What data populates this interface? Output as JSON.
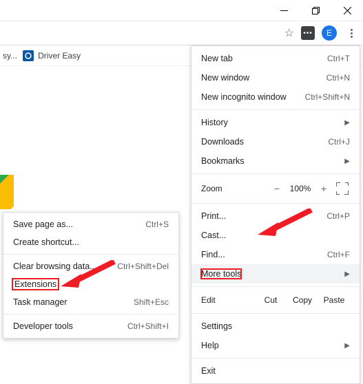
{
  "window": {
    "min": "—",
    "max": "❐",
    "close": "✕"
  },
  "toolbar": {
    "avatar_letter": "E",
    "ext_badge": "•••"
  },
  "bookmarks": {
    "truncated": "sy...",
    "driver_easy": "Driver Easy"
  },
  "menu": {
    "new_tab": "New tab",
    "new_tab_sc": "Ctrl+T",
    "new_window": "New window",
    "new_window_sc": "Ctrl+N",
    "incognito": "New incognito window",
    "incognito_sc": "Ctrl+Shift+N",
    "history": "History",
    "downloads": "Downloads",
    "downloads_sc": "Ctrl+J",
    "bookmarks": "Bookmarks",
    "zoom_label": "Zoom",
    "zoom_val": "100%",
    "print": "Print...",
    "print_sc": "Ctrl+P",
    "cast": "Cast...",
    "find": "Find...",
    "find_sc": "Ctrl+F",
    "more_tools": "More tools",
    "edit": "Edit",
    "cut": "Cut",
    "copy": "Copy",
    "paste": "Paste",
    "settings": "Settings",
    "help": "Help",
    "exit": "Exit"
  },
  "submenu": {
    "save_page": "Save page as...",
    "save_page_sc": "Ctrl+S",
    "create_shortcut": "Create shortcut...",
    "clear_data": "Clear browsing data...",
    "clear_data_sc": "Ctrl+Shift+Del",
    "extensions": "Extensions",
    "task_manager": "Task manager",
    "task_manager_sc": "Shift+Esc",
    "dev_tools": "Developer tools",
    "dev_tools_sc": "Ctrl+Shift+I"
  }
}
